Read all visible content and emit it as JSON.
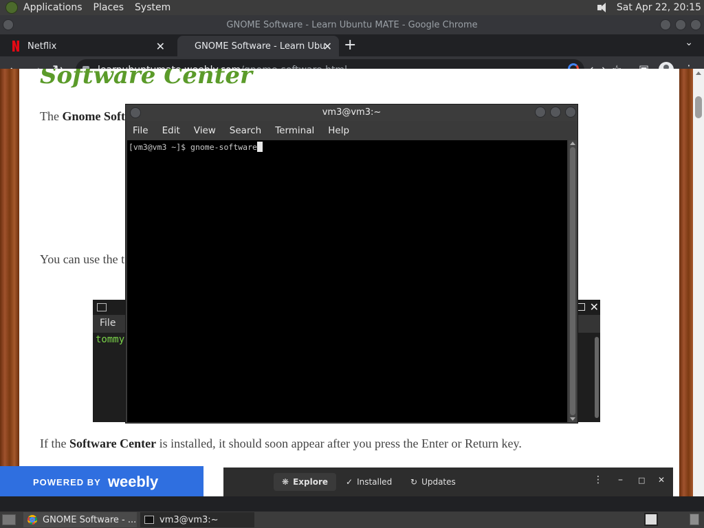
{
  "top_panel": {
    "menus": [
      "Applications",
      "Places",
      "System"
    ],
    "clock": "Sat Apr 22, 20:15"
  },
  "chrome": {
    "window_title": "GNOME Software - Learn Ubuntu MATE - Google Chrome",
    "tabs": [
      {
        "label": "Netflix",
        "close": "✕"
      },
      {
        "label": "GNOME Software - Learn Ubu",
        "close": "✕"
      }
    ],
    "new_tab": "+",
    "url_host": "learnubuntumate.weebly.com",
    "url_path": "/gnome-software.html"
  },
  "page": {
    "heading": "Software Center",
    "p1_html": "The <b>Gnome Soft</b>",
    "p2_text": "You can use the t",
    "embed_menu": "File",
    "embed_prompt": "tommy",
    "p3_pre": "If the ",
    "p3_bold": "Software Center",
    "p3_post": " is installed, it should soon appear after you press the Enter or Return key.",
    "weebly_powered": "POWERED BY",
    "weebly_brand": "weebly",
    "gs_tabs": [
      "Explore",
      "Installed",
      "Updates"
    ]
  },
  "terminal": {
    "title": "vm3@vm3:~",
    "menu": [
      "File",
      "Edit",
      "View",
      "Search",
      "Terminal",
      "Help"
    ],
    "prompt": "[vm3@vm3 ~]$ ",
    "command": "gnome-software"
  },
  "taskbar": {
    "tasks": [
      "GNOME Software - ...",
      "vm3@vm3:~"
    ]
  }
}
